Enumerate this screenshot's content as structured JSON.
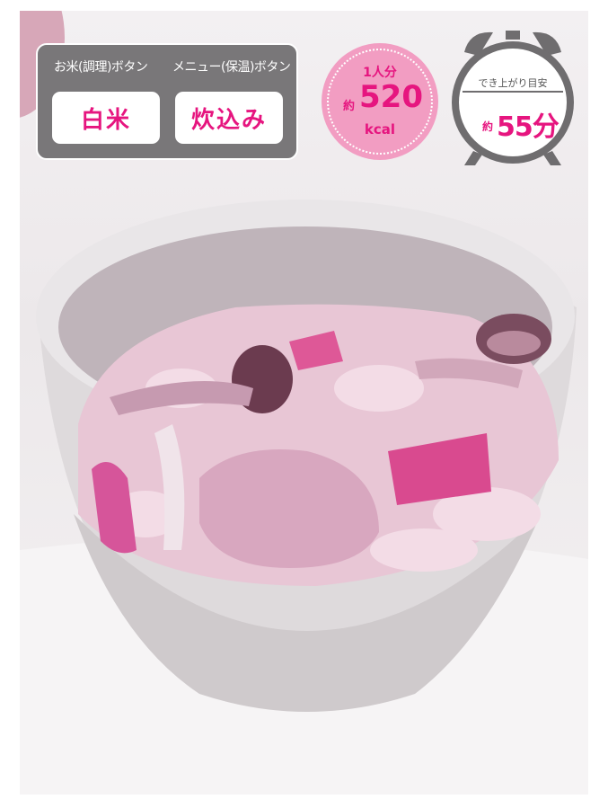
{
  "buttons": {
    "rice_label": "お米(調理)ボタン",
    "rice_value": "白米",
    "menu_label": "メニュー(保温)ボタン",
    "menu_value": "炊込み"
  },
  "calories": {
    "serving": "1人分",
    "approx": "約",
    "value": "520",
    "unit": "kcal"
  },
  "cook_time": {
    "label": "でき上がり目安",
    "approx": "約",
    "value": "55分"
  },
  "colors": {
    "accent": "#e6157f",
    "panel": "#797779",
    "badge": "#f29dc2"
  }
}
